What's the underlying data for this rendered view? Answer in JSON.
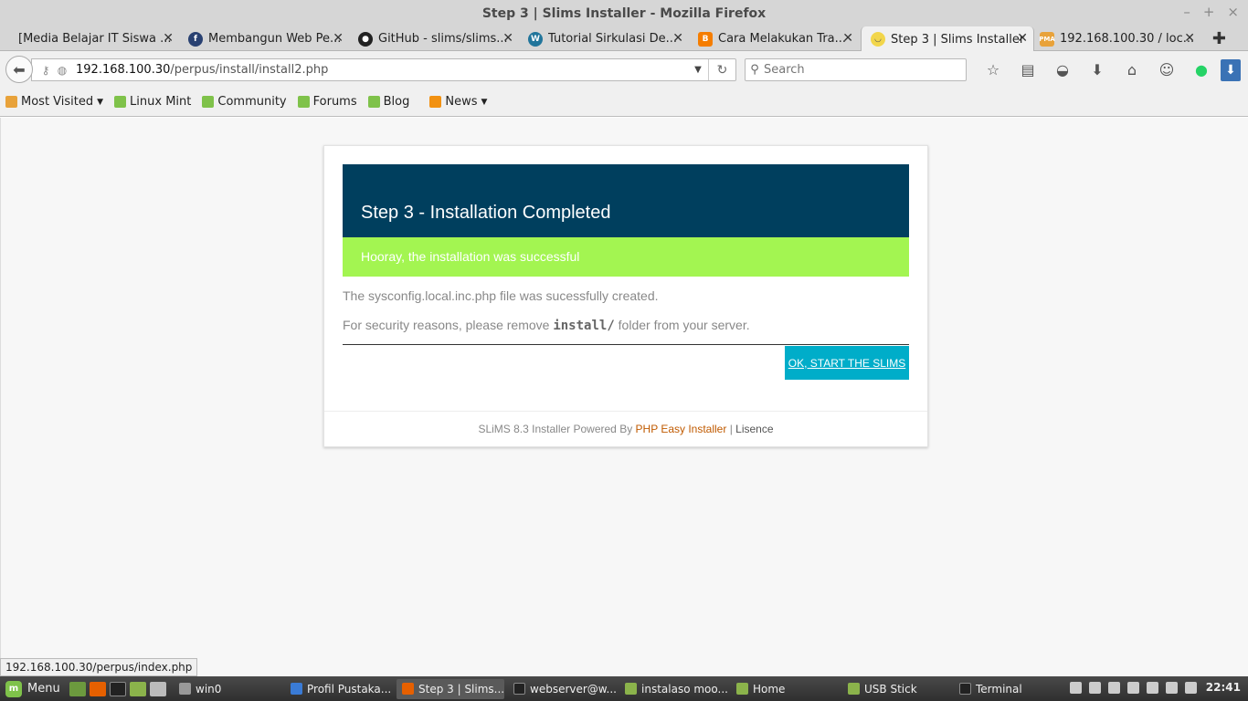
{
  "window": {
    "title": "Step 3 | Slims Installer - Mozilla Firefox",
    "controls": [
      "–",
      "+",
      "×"
    ]
  },
  "tabs": [
    {
      "label": "[Media Belajar IT Siswa ...",
      "icon": "blank-page-icon",
      "color": "#ffffff"
    },
    {
      "label": "Membangun Web Pe...",
      "icon": "fedora-icon",
      "color": "#294172"
    },
    {
      "label": "GitHub - slims/slims...",
      "icon": "github-icon",
      "color": "#222222"
    },
    {
      "label": "Tutorial Sirkulasi De...",
      "icon": "wordpress-icon",
      "color": "#21759b"
    },
    {
      "label": "Cara Melakukan Tra...",
      "icon": "blogger-icon",
      "color": "#f57d00"
    },
    {
      "label": "Step 3 | Slims Installer",
      "icon": "slims-icon",
      "color": "#f2d64b",
      "active": true
    },
    {
      "label": "192.168.100.30 / loc...",
      "icon": "phpmyadmin-icon",
      "color": "#e8a23a"
    }
  ],
  "nav": {
    "url_host": "192.168.100.30",
    "url_path": "/perpus/install/install2.php",
    "search_placeholder": "Search"
  },
  "bookmarks": [
    {
      "label": "Most Visited",
      "dropdown": true,
      "color": "#e8a23a"
    },
    {
      "label": "Linux Mint",
      "color": "#7fc24a"
    },
    {
      "label": "Community",
      "color": "#7fc24a"
    },
    {
      "label": "Forums",
      "color": "#7fc24a"
    },
    {
      "label": "Blog",
      "color": "#7fc24a"
    },
    {
      "label": "News",
      "dropdown": true,
      "color": "#f29111"
    }
  ],
  "installer": {
    "heading": "Step 3 - Installation Completed",
    "success": "Hooray, the installation was successful",
    "message1": "The sysconfig.local.inc.php file was sucessfully created.",
    "message2_prefix": "For security reasons, please remove ",
    "message2_code": "install/",
    "message2_suffix": " folder from your server.",
    "start_button": "OK, START THE SLIMS",
    "footer_prefix": "SLiMS 8.3 Installer Powered By ",
    "footer_link": "PHP Easy Installer",
    "footer_sep": " | ",
    "footer_license": "Lisence",
    "colors": {
      "header": "#003f5e",
      "success": "#a3f551",
      "button": "#00adc9"
    }
  },
  "status_link": "192.168.100.30/perpus/index.php",
  "taskbar": {
    "menu_label": "Menu",
    "tasks": [
      {
        "label": "win0",
        "icon": "gear-icon",
        "color": "#999999"
      },
      {
        "label": "Profil Pustaka...",
        "icon": "browser-icon",
        "color": "#3a7bd5"
      },
      {
        "label": "Step 3 | Slims...",
        "icon": "firefox-icon",
        "color": "#e66000",
        "active": true
      },
      {
        "label": "webserver@w...",
        "icon": "terminal-icon",
        "color": "#222222"
      },
      {
        "label": "instalaso moo...",
        "icon": "folder-icon",
        "color": "#8bb34b"
      },
      {
        "label": "Home",
        "icon": "folder-icon",
        "color": "#8bb34b"
      },
      {
        "label": "USB Stick",
        "icon": "folder-icon",
        "color": "#8bb34b"
      },
      {
        "label": "Terminal",
        "icon": "terminal-icon",
        "color": "#222222"
      }
    ],
    "clock": "22:41"
  }
}
